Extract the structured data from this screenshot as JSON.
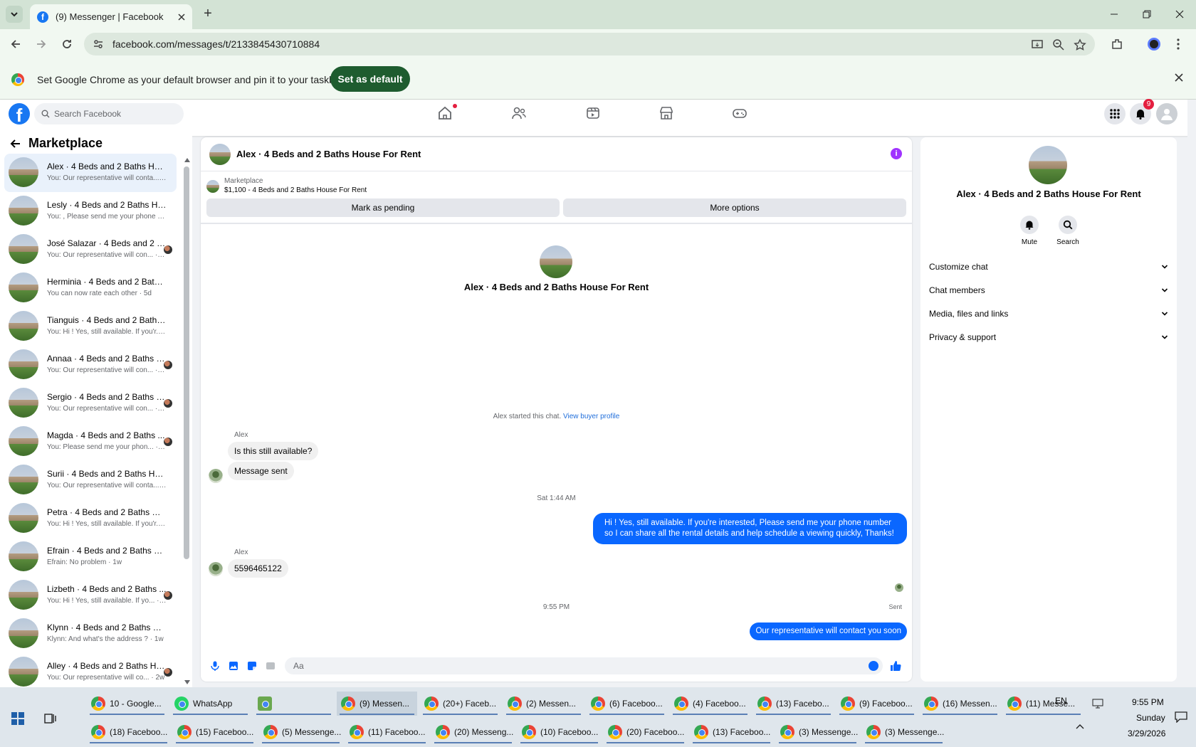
{
  "browser": {
    "tab_title": "(9) Messenger | Facebook",
    "url": "facebook.com/messages/t/2133845430710884",
    "infobar_message": "Set Google Chrome as your default browser and pin it to your taskbar",
    "infobar_button": "Set as default"
  },
  "fb": {
    "search_placeholder": "Search Facebook",
    "notification_count": "9"
  },
  "sidebar": {
    "title": "Marketplace",
    "conversations": [
      {
        "name": "Alex · 4 Beds and 2 Baths Hous...",
        "preview": "You: Our representative will conta... · 1m",
        "seen": false
      },
      {
        "name": "Lesly · 4 Beds and 2 Baths Hous...",
        "preview": "You: , Please send me your phone ... · 2h",
        "seen": false
      },
      {
        "name": "José Salazar · 4 Beds and 2 B...",
        "preview": "You: Our representative will con... · 2h",
        "seen": true
      },
      {
        "name": "Herminia · 4 Beds and 2 Baths ...",
        "preview": "You can now rate each other · 5d",
        "seen": false
      },
      {
        "name": "Tianguis · 4 Beds and 2 Baths H...",
        "preview": "You: Hi ! Yes, still available. If you'r... · 6d",
        "seen": false
      },
      {
        "name": "Annaa · 4 Beds and 2 Baths H...",
        "preview": "You: Our representative will con... · 6d",
        "seen": true
      },
      {
        "name": "Sergio · 4 Beds and 2 Baths H...",
        "preview": "You: Our representative will con... · 6d",
        "seen": true
      },
      {
        "name": "Magda · 4 Beds and 2 Baths ...",
        "preview": "You: Please send me your phon... · 1w",
        "seen": true
      },
      {
        "name": "Surii · 4 Beds and 2 Baths Hous...",
        "preview": "You: Our representative will conta... · 1w",
        "seen": false
      },
      {
        "name": "Petra · 4 Beds and 2 Baths Hous...",
        "preview": "You: Hi ! Yes, still available. If you'r... · 1w",
        "seen": false
      },
      {
        "name": "Efrain · 4 Beds and 2 Baths Hou...",
        "preview": "Efrain: No problem · 1w",
        "seen": false
      },
      {
        "name": "Lizbeth · 4 Beds and 2 Baths ...",
        "preview": "You: Hi ! Yes, still available. If yo... · 1w",
        "seen": true
      },
      {
        "name": "Klynn · 4 Beds and 2 Baths Hou...",
        "preview": "Klynn: And what's the address ? · 1w",
        "seen": false
      },
      {
        "name": "Alley · 4 Beds and 2 Baths Ho...",
        "preview": "You: Our representative will co... · 2w",
        "seen": true
      }
    ]
  },
  "chat": {
    "title": "Alex · 4 Beds and 2 Baths House For Rent",
    "listing_source": "Marketplace",
    "listing_line": "$1,100 - 4 Beds and 2 Baths House For Rent",
    "btn_pending": "Mark as pending",
    "btn_more": "More options",
    "center_name": "Alex · 4 Beds and 2 Baths House For Rent",
    "started_text": "Alex started this chat.",
    "started_link": "View buyer profile",
    "sender1": "Alex",
    "msg1": "Is this still available?",
    "msg2": "Message sent",
    "time1": "Sat 1:44 AM",
    "out1": "Hi ! Yes, still available. If you're interested, Please send me your phone number so I can share all the rental details and help schedule a viewing quickly, Thanks!",
    "sender2": "Alex",
    "msg3": "5596465122",
    "time2": "9:55 PM",
    "out2": "Our representative will contact you soon",
    "sent_label": "Sent",
    "composer_placeholder": "Aa"
  },
  "details": {
    "name": "Alex · 4 Beds and 2 Baths House For Rent",
    "mute": "Mute",
    "search": "Search",
    "rows": [
      "Customize chat",
      "Chat members",
      "Media, files and links",
      "Privacy & support"
    ]
  },
  "taskbar": {
    "row1": [
      "10 - Google...",
      "WhatsApp",
      "",
      "(9) Messen...",
      "(20+) Faceb...",
      "(2) Messen...",
      "(6) Faceboo...",
      "(4) Faceboo...",
      "(13) Facebo...",
      "(9) Faceboo...",
      "(16) Messen...",
      "(11) Messe..."
    ],
    "row2": [
      "(18) Faceboo...",
      "(15) Faceboo...",
      "(5) Messenge...",
      "(11) Faceboo...",
      "(20) Messeng...",
      "(10) Faceboo...",
      "(20) Faceboo...",
      "(13) Faceboo...",
      "(3) Messenge...",
      "(3) Messenge..."
    ],
    "lang": "EN",
    "time": "9:55 PM",
    "day": "Sunday",
    "date": "3/29/2026"
  }
}
